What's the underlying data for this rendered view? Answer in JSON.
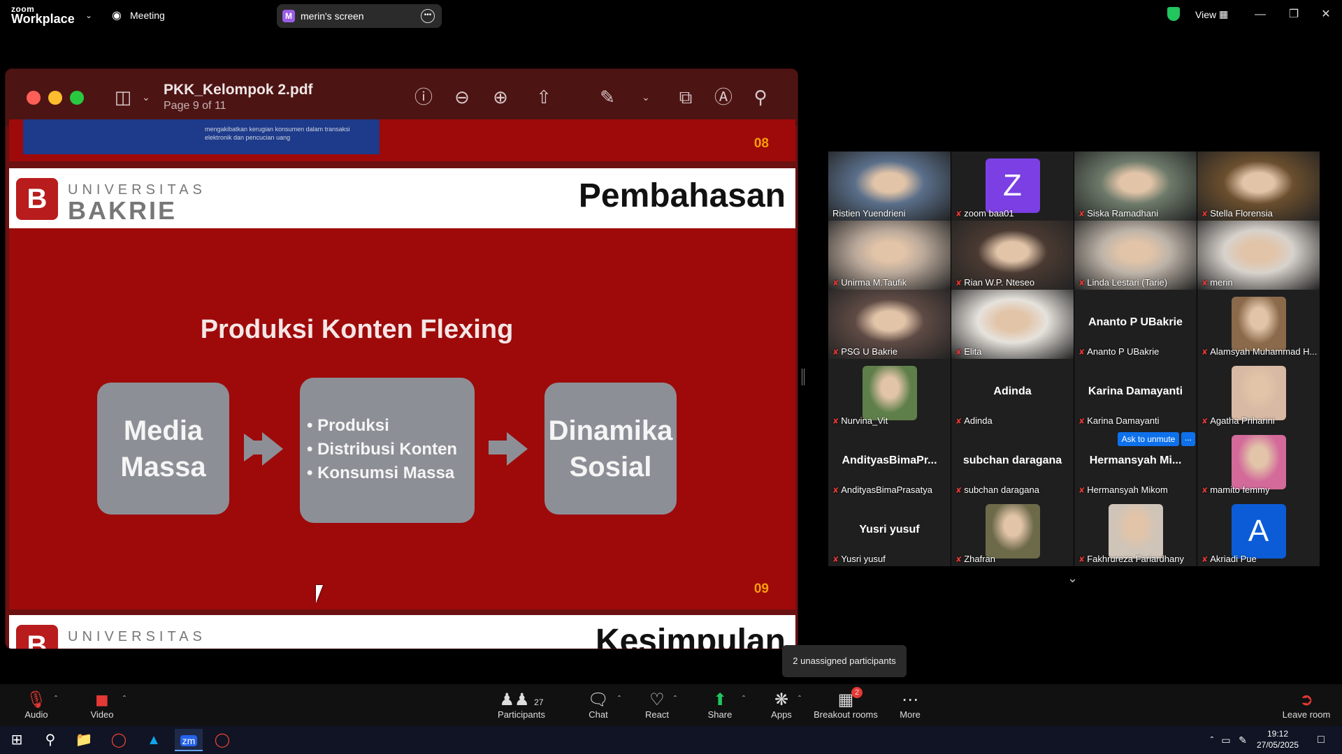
{
  "topbar": {
    "brand_small": "zoom",
    "brand_large": "Workplace",
    "meeting_label": "Meeting",
    "share_badge": "M",
    "share_label": "merin's screen",
    "view_label": "View"
  },
  "pdf": {
    "title": "PKK_Kelompok 2.pdf",
    "subtitle": "Page 9 of 11",
    "prev_slide_num": "08",
    "prev_slide_text": "mengakibatkan kerugian konsumen dalam transaksi elektronik dan pencucian uang",
    "logo_line1": "UNIVERSITAS",
    "logo_line2": "BAKRIE",
    "heading": "Pembahasan",
    "slide_title": "Produksi Konten Flexing",
    "box1": "Media Massa",
    "box2_items": [
      "Produksi",
      "Distribusi  Konten",
      "Konsumsi Massa"
    ],
    "box3": "Dinamika Sosial",
    "slide_num": "09",
    "next_heading": "Kesimpulan"
  },
  "gallery": {
    "participants": [
      {
        "name": "Ristien Yuendrieni",
        "type": "photo",
        "color": "#5a6f8a"
      },
      {
        "name": "zoom baa01",
        "type": "avatar",
        "letter": "Z",
        "color": "#7b3fe4"
      },
      {
        "name": "Siska Ramadhani",
        "type": "photo",
        "color": "#6d7a6a"
      },
      {
        "name": "Stella Florensia",
        "type": "photo",
        "color": "#6b4f2e"
      },
      {
        "name": "Unirma M.Taufik",
        "type": "photo",
        "color": "#b9a89a"
      },
      {
        "name": "Rian W.P. Nteseo",
        "type": "photo",
        "color": "#4a3a32"
      },
      {
        "name": "Linda Lestari (Tarie)",
        "type": "photo",
        "color": "#bdb3a8"
      },
      {
        "name": "merin",
        "type": "photo",
        "color": "#d8d2cc"
      },
      {
        "name": "PSG U Bakrie",
        "type": "photo",
        "color": "#5e4a44"
      },
      {
        "name": "Elita",
        "type": "photo",
        "color": "#e6e2dc"
      },
      {
        "name": "Ananto P UBakrie",
        "type": "text",
        "big": "Ananto P UBakrie"
      },
      {
        "name": "Alamsyah Muhammad H...",
        "type": "small-photo",
        "color": "#8a6a4a"
      },
      {
        "name": "Nurvina_Vit",
        "type": "small-photo",
        "color": "#5f7f4a"
      },
      {
        "name": "Adinda",
        "type": "text",
        "big": "Adinda"
      },
      {
        "name": "Karina Damayanti",
        "type": "text",
        "big": "Karina Damayanti"
      },
      {
        "name": "Agatha Priharini",
        "type": "small-photo",
        "color": "#d7b9a4"
      },
      {
        "name": "AndityasBimaPrasatya",
        "type": "text",
        "big": "AndityasBimaPr..."
      },
      {
        "name": "subchan daragana",
        "type": "text",
        "big": "subchan daragana"
      },
      {
        "name": "Hermansyah Mikom",
        "type": "text",
        "big": "Hermansyah  Mi..."
      },
      {
        "name": "mamito femmy",
        "type": "small-photo",
        "color": "#d36a9a"
      },
      {
        "name": "Yusri yusuf",
        "type": "text",
        "big": "Yusri yusuf"
      },
      {
        "name": "Zhafran",
        "type": "small-photo",
        "color": "#6d6a4a"
      },
      {
        "name": "Fakhrureza Fariardhany",
        "type": "small-photo",
        "color": "#cfc4b8"
      },
      {
        "name": "Akriadi Pue",
        "type": "avatar-small",
        "letter": "A",
        "color": "#0b5cd6"
      }
    ],
    "ask_unmute": "Ask to unmute",
    "ask_more": "...",
    "unassigned_tooltip": "2 unassigned participants"
  },
  "toolbar": {
    "audio": "Audio",
    "video": "Video",
    "participants": "Participants",
    "participants_count": "27",
    "chat": "Chat",
    "react": "React",
    "share": "Share",
    "apps": "Apps",
    "breakout": "Breakout rooms",
    "breakout_badge": "2",
    "more": "More",
    "leave": "Leave room"
  },
  "taskbar": {
    "time": "19:12",
    "date": "27/05/2025"
  }
}
